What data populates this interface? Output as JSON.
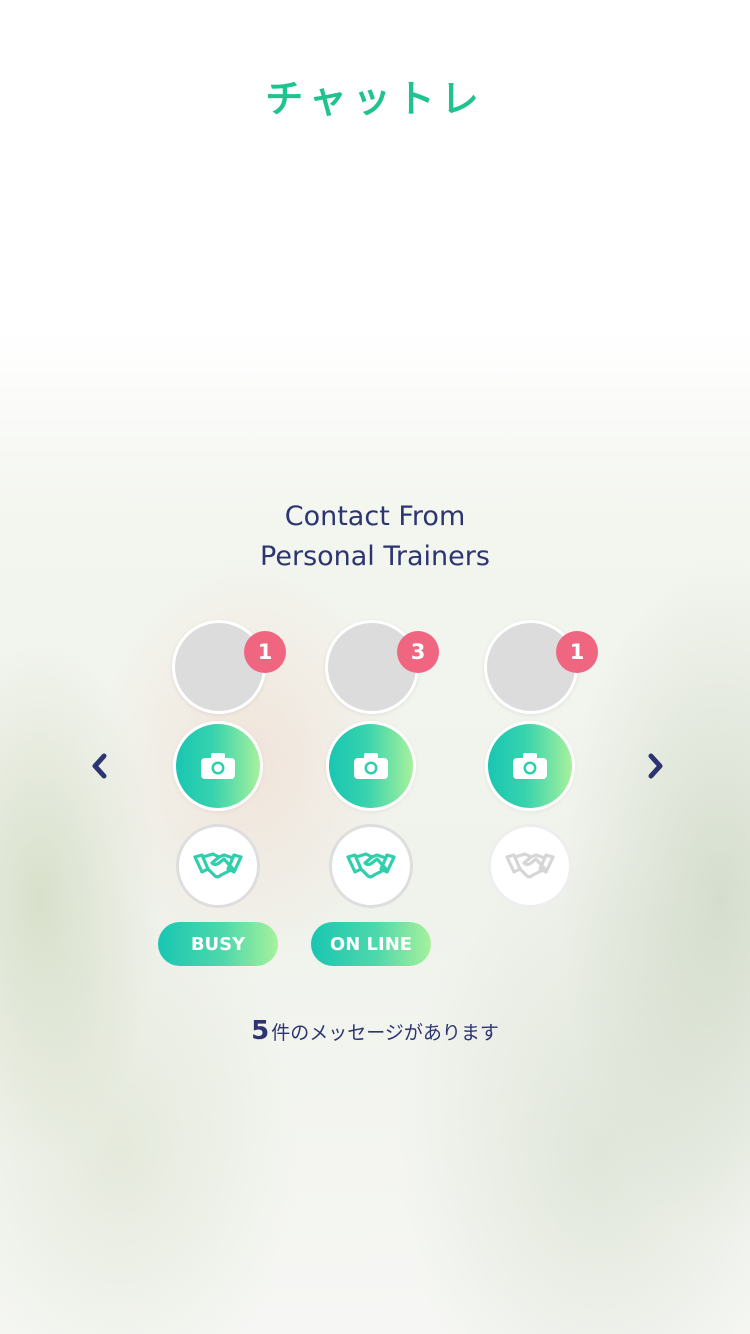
{
  "app": {
    "logo_text": "チャットレ"
  },
  "heading": {
    "line1": "Contact From",
    "line2": "Personal Trainers"
  },
  "colors": {
    "brand_green": "#20c38f",
    "navy": "#2d3570",
    "badge_pink": "#f06580",
    "gradient_start": "#18c6b2",
    "gradient_end": "#a7f19c"
  },
  "navigation": {
    "prev_icon": "chevron-left-icon",
    "next_icon": "chevron-right-icon"
  },
  "trainers": [
    {
      "badge": "1",
      "status": "BUSY",
      "camera_icon": "camera-icon",
      "handshake_icon": "handshake-icon",
      "handshake_active": true
    },
    {
      "badge": "3",
      "status": "ON LINE",
      "camera_icon": "camera-icon",
      "handshake_icon": "handshake-icon",
      "handshake_active": true
    },
    {
      "badge": "1",
      "status": "",
      "camera_icon": "camera-icon",
      "handshake_icon": "handshake-icon",
      "handshake_active": false
    }
  ],
  "message": {
    "count": "5",
    "text": "件のメッセージがあります"
  }
}
